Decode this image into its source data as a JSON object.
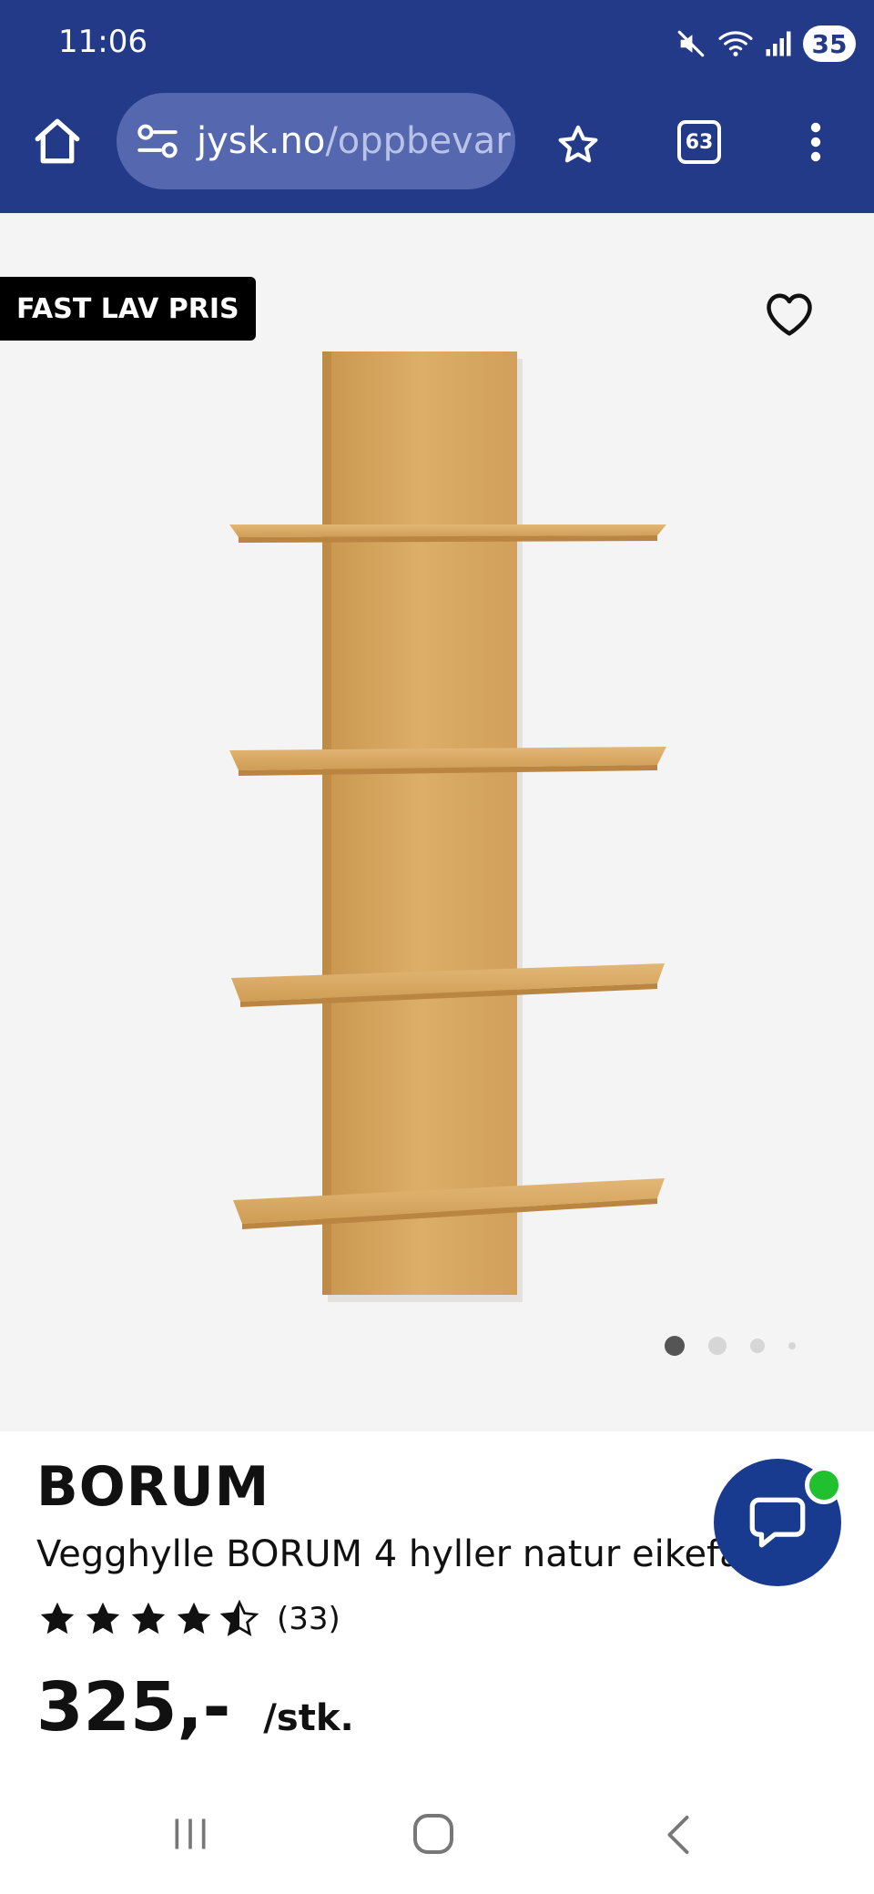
{
  "status_bar": {
    "time": "11:06",
    "battery": "35",
    "icons": [
      "mute-icon",
      "wifi-icon",
      "signal-icon",
      "battery-icon"
    ]
  },
  "browser": {
    "url_host": "jysk.no",
    "url_path": "/oppbevar",
    "tab_count": "63",
    "icons": [
      "home-icon",
      "site-settings-icon",
      "star-icon",
      "tabs-icon",
      "more-vert-icon"
    ]
  },
  "gallery": {
    "badge": "FAST LAV PRIS",
    "image_count": 4,
    "active_image": 1
  },
  "product": {
    "brand": "BORUM",
    "description": "Vegghylle BORUM 4 hyller natur eikefarge",
    "rating_value": 4.5,
    "rating_max": 5,
    "rating_count": "(33)",
    "price": "325,-",
    "price_unit": "/stk."
  },
  "colors": {
    "header": "#233a88",
    "url_pill": "#5567ae",
    "chat_button": "#183b8f",
    "online_dot": "#20c02e",
    "gallery_bg": "#f4f4f4"
  }
}
